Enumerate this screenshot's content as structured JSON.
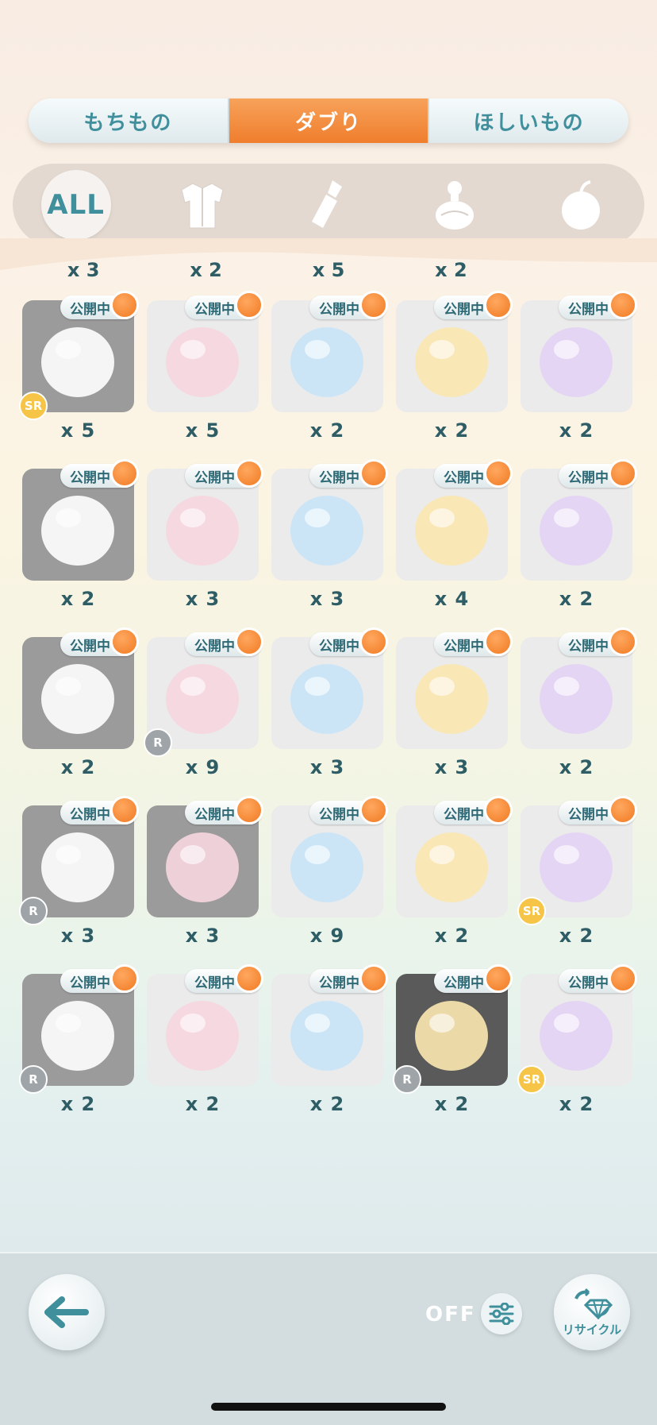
{
  "tabs": [
    {
      "label": "もちもの"
    },
    {
      "label": "ダブり"
    },
    {
      "label": "ほしいもの"
    }
  ],
  "categories": {
    "all_label": "ALL",
    "icons": [
      "clothing-icon",
      "lipstick-icon",
      "perfume-icon",
      "fruit-icon"
    ]
  },
  "previous_row_counts": [
    "x 3",
    "x 2",
    "x 5",
    "x 2"
  ],
  "items": [
    {
      "status": "公開中",
      "count": "x 5",
      "rarity": "SR",
      "icon": "cake-table-icon"
    },
    {
      "status": "公開中",
      "count": "x 5",
      "rarity": "",
      "icon": "shortcake-icon"
    },
    {
      "status": "公開中",
      "count": "x 2",
      "rarity": "",
      "icon": "carousel-icon"
    },
    {
      "status": "公開中",
      "count": "x 2",
      "rarity": "",
      "icon": "round-rug-icon"
    },
    {
      "status": "公開中",
      "count": "x 2",
      "rarity": "",
      "icon": "balloon-bench-icon"
    },
    {
      "status": "公開中",
      "count": "x 2",
      "rarity": "",
      "icon": "cat-pillow-icon"
    },
    {
      "status": "公開中",
      "count": "x 3",
      "rarity": "",
      "icon": "fish-cushion-icon"
    },
    {
      "status": "公開中",
      "count": "x 3",
      "rarity": "",
      "icon": "kettle-icon"
    },
    {
      "status": "公開中",
      "count": "x 4",
      "rarity": "",
      "icon": "bunny-doll-icon"
    },
    {
      "status": "公開中",
      "count": "x 2",
      "rarity": "",
      "icon": "gift-box-icon"
    },
    {
      "status": "公開中",
      "count": "x 2",
      "rarity": "",
      "icon": "snowman-icon"
    },
    {
      "status": "公開中",
      "count": "x 9",
      "rarity": "R",
      "icon": "band-animals-icon"
    },
    {
      "status": "公開中",
      "count": "x 3",
      "rarity": "",
      "icon": "balloon-cart-icon"
    },
    {
      "status": "公開中",
      "count": "x 3",
      "rarity": "",
      "icon": "dotted-dress-icon"
    },
    {
      "status": "公開中",
      "count": "x 2",
      "rarity": "",
      "icon": "mannequin-icon"
    },
    {
      "status": "公開中",
      "count": "x 3",
      "rarity": "R",
      "icon": "headphones-icon"
    },
    {
      "status": "公開中",
      "count": "x 3",
      "rarity": "",
      "icon": "black-skirt-icon"
    },
    {
      "status": "公開中",
      "count": "x 9",
      "rarity": "",
      "icon": "blue-star-icon"
    },
    {
      "status": "公開中",
      "count": "x 2",
      "rarity": "",
      "icon": "bunny-top-icon"
    },
    {
      "status": "公開中",
      "count": "x 2",
      "rarity": "SR",
      "icon": "doll-face-icon"
    },
    {
      "status": "公開中",
      "count": "x 2",
      "rarity": "R",
      "icon": "night-body-icon"
    },
    {
      "status": "公開中",
      "count": "x 2",
      "rarity": "",
      "icon": "macaron-icon"
    },
    {
      "status": "公開中",
      "count": "x 2",
      "rarity": "",
      "icon": "flower-hair-icon"
    },
    {
      "status": "公開中",
      "count": "x 2",
      "rarity": "R",
      "icon": "polka-wallpaper-icon"
    },
    {
      "status": "公開中",
      "count": "x 2",
      "rarity": "SR",
      "icon": "gift-table-icon"
    }
  ],
  "bottom_bar": {
    "off_label": "OFF",
    "recycle_label": "リサイクル"
  },
  "colors": {
    "accent_orange": "#ef7e2d",
    "teal_text": "#3f8f9c"
  }
}
